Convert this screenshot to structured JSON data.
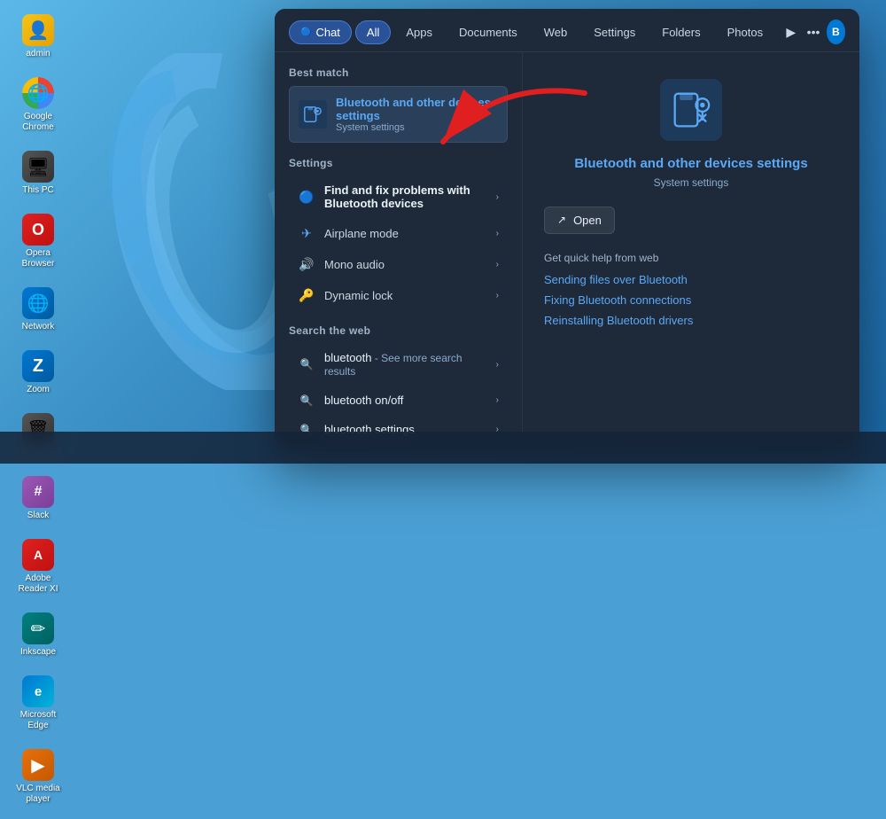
{
  "desktop": {
    "background": "#4a9fd4"
  },
  "icons": [
    {
      "id": "admin",
      "label": "admin",
      "emoji": "👤",
      "colorClass": "icon-yellow"
    },
    {
      "id": "chrome",
      "label": "Google Chrome",
      "emoji": "🌐",
      "colorClass": "icon-chrome"
    },
    {
      "id": "this-pc",
      "label": "This PC",
      "emoji": "🖥",
      "colorClass": "icon-gray"
    },
    {
      "id": "opera",
      "label": "Opera Browser",
      "emoji": "O",
      "colorClass": "icon-red"
    },
    {
      "id": "network",
      "label": "Network",
      "emoji": "🌐",
      "colorClass": "icon-blue"
    },
    {
      "id": "zoom",
      "label": "Zoom",
      "emoji": "Z",
      "colorClass": "icon-blue"
    },
    {
      "id": "recycle",
      "label": "Recycle Bin",
      "emoji": "🗑",
      "colorClass": "icon-gray"
    },
    {
      "id": "slack",
      "label": "Slack",
      "emoji": "#",
      "colorClass": "icon-purple"
    },
    {
      "id": "adobe",
      "label": "Adobe Reader XI",
      "emoji": "A",
      "colorClass": "icon-red"
    },
    {
      "id": "inkscape",
      "label": "Inkscape",
      "emoji": "✏",
      "colorClass": "icon-teal"
    },
    {
      "id": "edge",
      "label": "Microsoft Edge",
      "emoji": "e",
      "colorClass": "icon-edge"
    },
    {
      "id": "vlc",
      "label": "VLC media player",
      "emoji": "▶",
      "colorClass": "icon-vlc"
    }
  ],
  "start_menu": {
    "nav_tabs": [
      {
        "id": "chat",
        "label": "Chat",
        "active": false,
        "chat": true
      },
      {
        "id": "all",
        "label": "All",
        "active": true
      },
      {
        "id": "apps",
        "label": "Apps"
      },
      {
        "id": "documents",
        "label": "Documents"
      },
      {
        "id": "web",
        "label": "Web"
      },
      {
        "id": "settings",
        "label": "Settings"
      },
      {
        "id": "folders",
        "label": "Folders"
      },
      {
        "id": "photos",
        "label": "Photos"
      }
    ],
    "best_match": {
      "section_title": "Best match",
      "title_prefix": "Bluetooth",
      "title_suffix": " and other devices settings",
      "subtitle": "System settings"
    },
    "settings_section": {
      "title": "Settings",
      "items": [
        {
          "id": "bluetooth-fix",
          "icon": "🔵",
          "label_bold": "Find and fix problems with",
          "label_bold2": "Bluetooth devices",
          "label_rest": ""
        },
        {
          "id": "airplane",
          "icon": "✈",
          "label": "Airplane mode"
        },
        {
          "id": "mono",
          "icon": "🔊",
          "label": "Mono audio"
        },
        {
          "id": "dynamic-lock",
          "icon": "🔑",
          "label": "Dynamic lock"
        }
      ]
    },
    "web_section": {
      "title": "Search the web",
      "items": [
        {
          "id": "bt1",
          "query": "bluetooth",
          "desc": " - See more search results"
        },
        {
          "id": "bt2",
          "query": "bluetooth on/off",
          "desc": ""
        },
        {
          "id": "bt3",
          "query": "bluetooth settings",
          "desc": ""
        }
      ]
    },
    "detail_panel": {
      "title_prefix": "Bluetooth",
      "title_suffix": " and other devices settings",
      "subtitle": "System settings",
      "open_label": "Open",
      "quick_help_title": "Get quick help from web",
      "links": [
        "Sending files over Bluetooth",
        "Fixing Bluetooth connections",
        "Reinstalling Bluetooth drivers"
      ]
    }
  }
}
